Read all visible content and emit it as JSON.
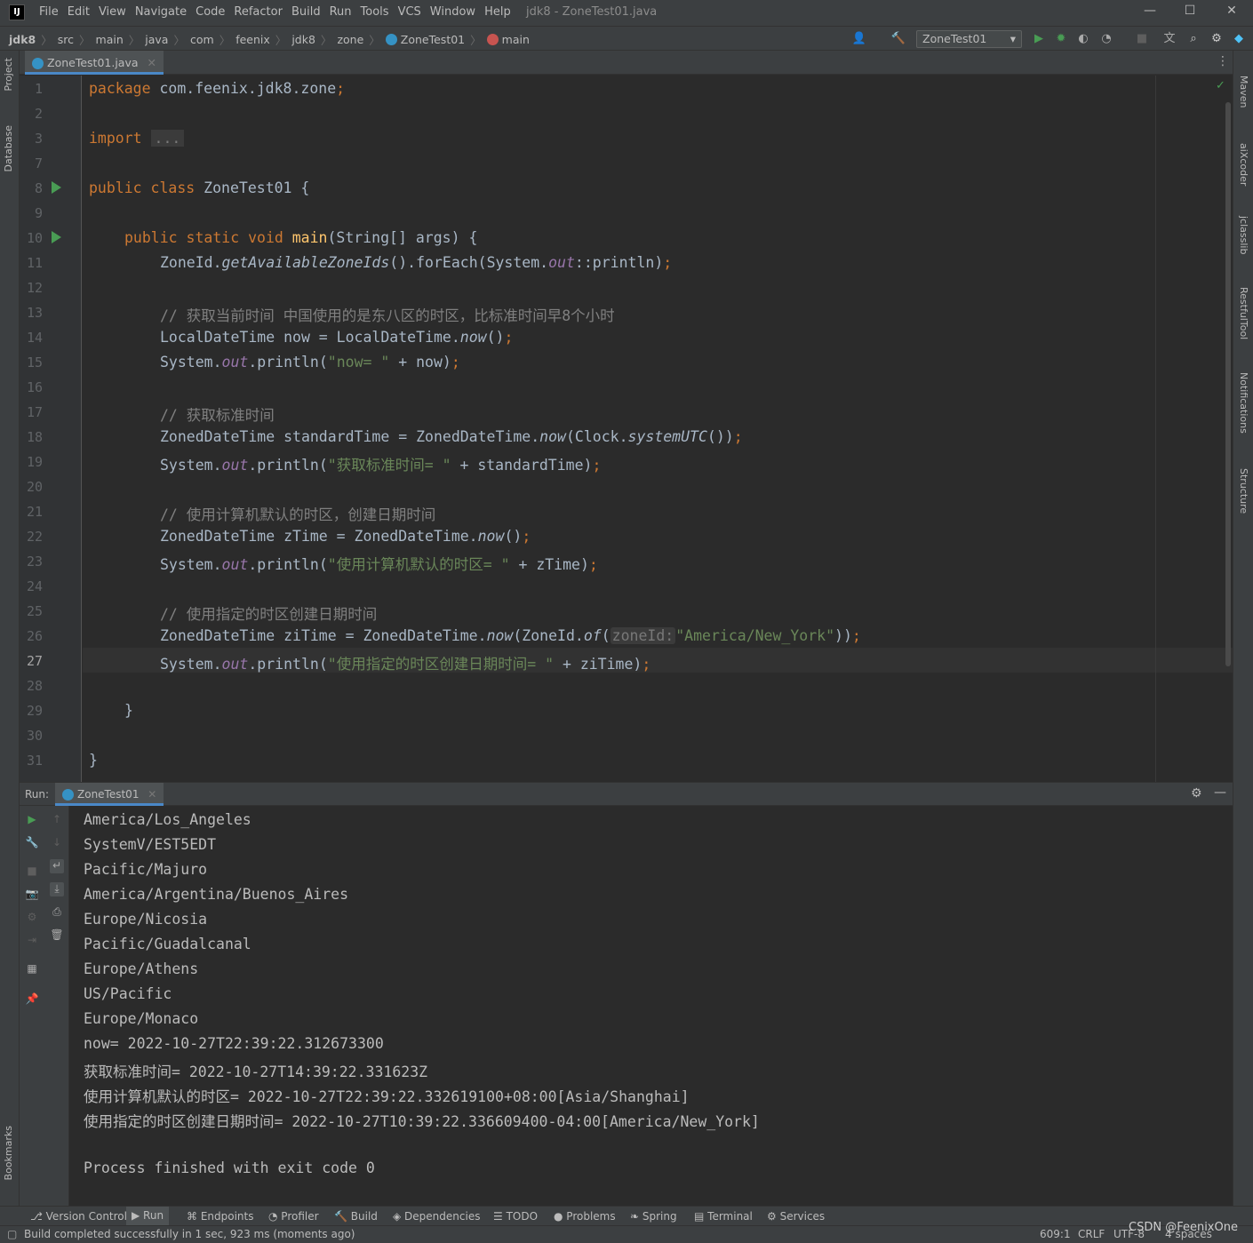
{
  "app": {
    "title": "jdk8 - ZoneTest01.java",
    "logo": "IJ"
  },
  "menu": [
    "File",
    "Edit",
    "View",
    "Navigate",
    "Code",
    "Refactor",
    "Build",
    "Run",
    "Tools",
    "VCS",
    "Window",
    "Help"
  ],
  "breadcrumb": [
    "jdk8",
    "src",
    "main",
    "java",
    "com",
    "feenix",
    "jdk8",
    "zone",
    "ZoneTest01",
    "main"
  ],
  "run_config": "ZoneTest01",
  "left_tools": [
    "Project",
    "Database",
    "Bookmarks"
  ],
  "right_tools": [
    "Maven",
    "aiXcoder",
    "jclasslib",
    "RestfulTool",
    "Notifications",
    "Structure"
  ],
  "editor_tab": "ZoneTest01.java",
  "line_numbers": [
    "1",
    "2",
    "3",
    "7",
    "8",
    "9",
    "10",
    "11",
    "12",
    "13",
    "14",
    "15",
    "16",
    "17",
    "18",
    "19",
    "20",
    "21",
    "22",
    "23",
    "24",
    "25",
    "26",
    "27",
    "28",
    "29",
    "30",
    "31"
  ],
  "code": {
    "l1_kw": "package",
    "l1_rest": " com.feenix.jdk8.zone",
    "l3_kw": "import",
    "l3_fold": "...",
    "l8_kw": "public class",
    "l8_rest": " ZoneTest01 {",
    "l10_kw": "public static void",
    "l10_fn": "main",
    "l10_rest": "(String[] args) {",
    "l11_a": "ZoneId.",
    "l11_b": "getAvailableZoneIds",
    "l11_c": "().forEach(System.",
    "l11_d": "out",
    "l11_e": "::println)",
    "l13": "// 获取当前时间 中国使用的是东八区的时区，比标准时间早8个小时",
    "l14_a": "LocalDateTime now = LocalDateTime.",
    "l14_b": "now",
    "l14_c": "()",
    "l15_a": "System.",
    "l15_b": "out",
    "l15_c": ".println(",
    "l15_str": "\"now= \"",
    "l15_d": " + now)",
    "l17": "// 获取标准时间",
    "l18_a": "ZonedDateTime standardTime = ZonedDateTime.",
    "l18_b": "now",
    "l18_c": "(Clock.",
    "l18_d": "systemUTC",
    "l18_e": "())",
    "l19_a": "System.",
    "l19_b": "out",
    "l19_c": ".println(",
    "l19_str": "\"获取标准时间= \"",
    "l19_d": " + standardTime)",
    "l21": "// 使用计算机默认的时区，创建日期时间",
    "l22_a": "ZonedDateTime zTime = ZonedDateTime.",
    "l22_b": "now",
    "l22_c": "()",
    "l23_a": "System.",
    "l23_b": "out",
    "l23_c": ".println(",
    "l23_str": "\"使用计算机默认的时区= \"",
    "l23_d": " + zTime)",
    "l25": "// 使用指定的时区创建日期时间",
    "l26_a": "ZonedDateTime ziTime = ZonedDateTime.",
    "l26_b": "now",
    "l26_c": "(ZoneId.",
    "l26_d": "of",
    "l26_e": "(",
    "l26_hint": "zoneId:",
    "l26_str": "\"America/New_York\"",
    "l26_f": "))",
    "l27_a": "System.",
    "l27_b": "out",
    "l27_c": ".println(",
    "l27_str": "\"使用指定的时区创建日期时间= \"",
    "l27_d": " + ziTime)",
    "semicolon": ";",
    "close_brace": "}"
  },
  "run": {
    "label": "Run:",
    "tab": "ZoneTest01",
    "output": [
      "America/Los_Angeles",
      "SystemV/EST5EDT",
      "Pacific/Majuro",
      "America/Argentina/Buenos_Aires",
      "Europe/Nicosia",
      "Pacific/Guadalcanal",
      "Europe/Athens",
      "US/Pacific",
      "Europe/Monaco",
      "now= 2022-10-27T22:39:22.312673300",
      "获取标准时间= 2022-10-27T14:39:22.331623Z",
      "使用计算机默认的时区= 2022-10-27T22:39:22.332619100+08:00[Asia/Shanghai]",
      "使用指定的时区创建日期时间= 2022-10-27T10:39:22.336609400-04:00[America/New_York]",
      "",
      "Process finished with exit code 0"
    ]
  },
  "bottom_tabs": [
    "Version Control",
    "Run",
    "Endpoints",
    "Profiler",
    "Build",
    "Dependencies",
    "TODO",
    "Problems",
    "Spring",
    "Terminal",
    "Services"
  ],
  "status": {
    "message": "Build completed successfully in 1 sec, 923 ms (moments ago)",
    "position": "609:1",
    "line_sep": "CRLF",
    "encoding": "UTF-8",
    "indent": "4 spaces",
    "watermark": "CSDN @FeenixOne"
  },
  "colors": {
    "keyword": "#cc7832",
    "string": "#6a8759",
    "comment": "#808080",
    "static_field": "#9876aa",
    "method_decl": "#ffc66d",
    "accent": "#4a88c7"
  }
}
